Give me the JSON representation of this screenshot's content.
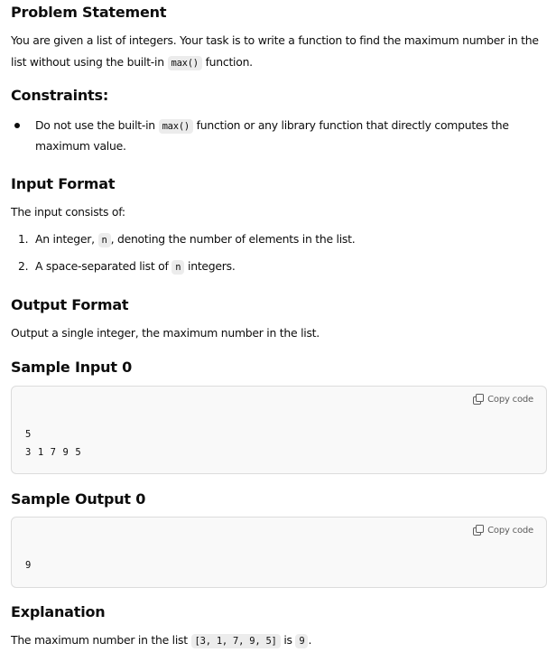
{
  "problem_statement": {
    "heading": "Problem Statement",
    "text_line1": "You are given a list of integers. Your task is to write a function to find the maximum number in the",
    "text_line2_before": "list without using the built-in ",
    "text_line2_code": "max()",
    "text_line2_after": " function."
  },
  "constraints": {
    "heading": "Constraints:",
    "items": [
      {
        "before": "Do not use the built-in ",
        "code": "max()",
        "after_line1": " function or any library function that directly computes the",
        "line2": "maximum value."
      }
    ]
  },
  "input_format": {
    "heading": "Input Format",
    "intro": "The input consists of:",
    "items": [
      {
        "number": "1.",
        "before": "An integer, ",
        "code": "n",
        "after": ", denoting the number of elements in the list."
      },
      {
        "number": "2.",
        "before": "A space-separated list of ",
        "code": "n",
        "after": " integers."
      }
    ]
  },
  "output_format": {
    "heading": "Output Format",
    "text": "Output a single integer, the maximum number in the list."
  },
  "sample_input": {
    "heading": "Sample Input 0",
    "copy_label": "Copy code",
    "code": "5\n3 1 7 9 5"
  },
  "sample_output": {
    "heading": "Sample Output 0",
    "copy_label": "Copy code",
    "code": "9"
  },
  "explanation": {
    "heading": "Explanation",
    "before": "The maximum number in the list ",
    "code1": "[3, 1, 7, 9, 5]",
    "middle": " is ",
    "code2": "9",
    "after": "."
  }
}
